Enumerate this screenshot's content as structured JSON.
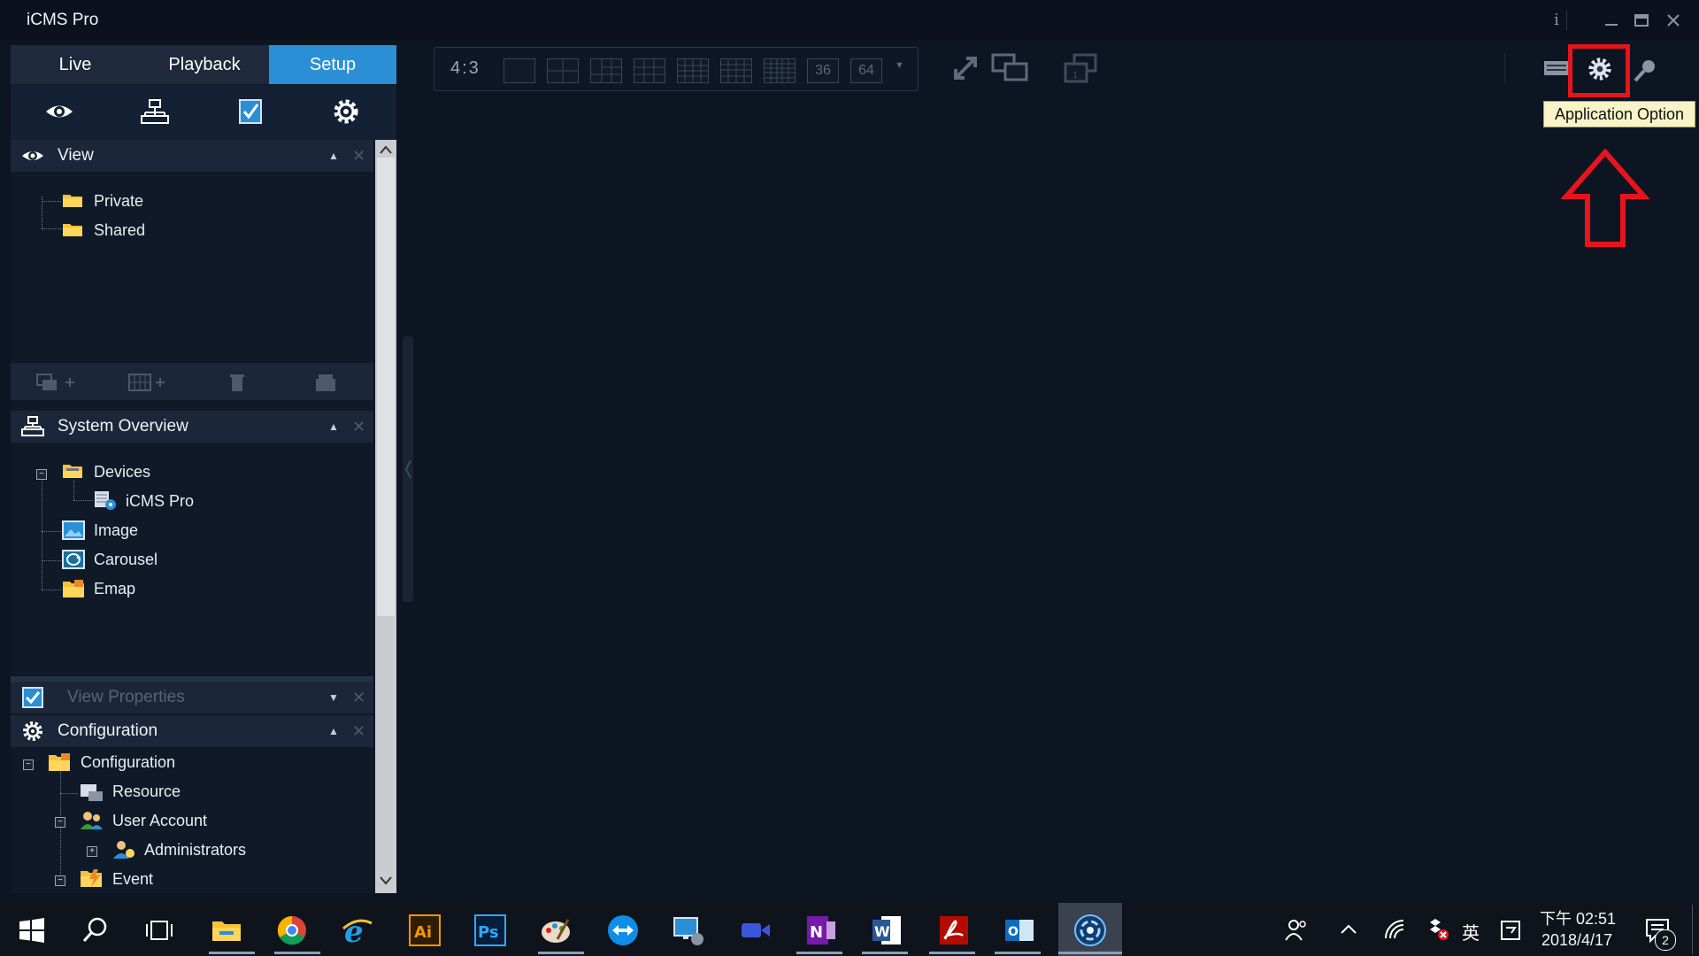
{
  "app": {
    "title": "iCMS Pro",
    "info": "i"
  },
  "tabs": [
    {
      "label": "Live"
    },
    {
      "label": "Playback"
    },
    {
      "label": "Setup"
    }
  ],
  "view_section": {
    "title": "View",
    "items": [
      {
        "label": "Private"
      },
      {
        "label": "Shared"
      }
    ]
  },
  "system_overview": {
    "title": "System Overview",
    "devices": "Devices",
    "device_child": "iCMS Pro",
    "image": "Image",
    "carousel": "Carousel",
    "emap": "Emap"
  },
  "view_properties": {
    "title": "View Properties"
  },
  "configuration": {
    "title": "Configuration",
    "root": "Configuration",
    "resource": "Resource",
    "user_account": "User Account",
    "administrators": "Administrators",
    "event": "Event"
  },
  "toolbar": {
    "aspect": "4:3",
    "layout_36": "36",
    "layout_64": "64"
  },
  "tooltip": {
    "text": "Application Option"
  },
  "taskbar": {
    "time": "下午 02:51",
    "date": "2018/4/17",
    "ime": "英",
    "notifications": "2"
  },
  "colors": {
    "accent": "#2b8fd6",
    "highlight": "#e8141c",
    "tooltip_bg": "#f8f4c8"
  }
}
